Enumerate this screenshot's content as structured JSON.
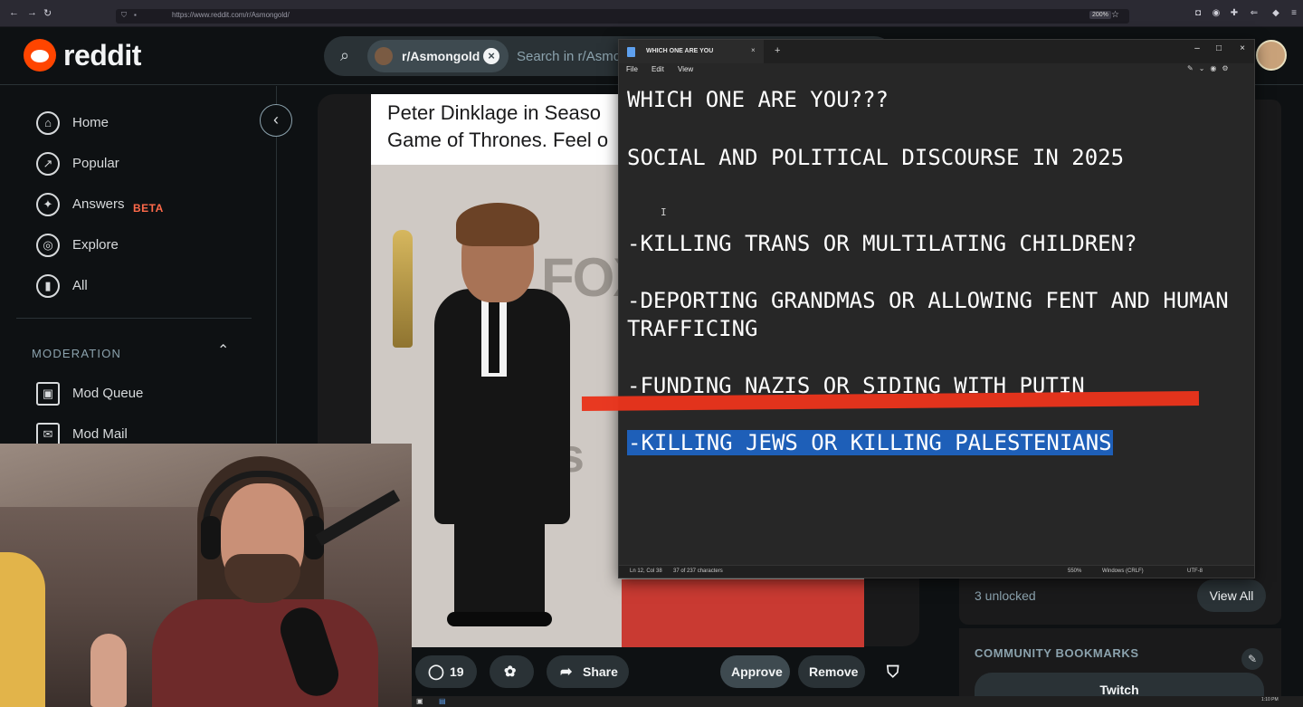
{
  "browser": {
    "url": "https://www.reddit.com/r/Asmongold/",
    "zoom": "200%",
    "nav_back": "←",
    "nav_forward": "→",
    "nav_reload": "↻"
  },
  "header": {
    "wordmark": "reddit",
    "subreddit_chip": "r/Asmongold",
    "chip_close": "×",
    "search_placeholder": "Search in r/Asmongold",
    "search_glyph": "⌕"
  },
  "sidebar": {
    "collapse_glyph": "‹",
    "items": [
      {
        "label": "Home",
        "icon": "home-icon",
        "glyph": "⌂"
      },
      {
        "label": "Popular",
        "icon": "popular-icon",
        "glyph": "↗"
      },
      {
        "label": "Answers",
        "icon": "answers-icon",
        "glyph": "✦"
      },
      {
        "label": "Explore",
        "icon": "explore-icon",
        "glyph": "◎"
      },
      {
        "label": "All",
        "icon": "all-icon",
        "glyph": "▮"
      }
    ],
    "answers_badge": "BETA",
    "moderation_heading": "MODERATION",
    "moderation_chevron": "⌃",
    "mod_items": [
      {
        "label": "Mod Queue",
        "icon": "mod-queue-icon",
        "glyph": "▣"
      },
      {
        "label": "Mod Mail",
        "icon": "mod-mail-icon",
        "glyph": "✉"
      }
    ]
  },
  "post": {
    "caption": "Peter Dinklage in Season Game of Thrones. Feel",
    "caption_line1": "Peter Dinklage in Seaso",
    "caption_line2": "Game of Thrones. Feel o",
    "backdrop_text_1": "FOX",
    "backdrop_text_2": "ys",
    "comment_count": "19",
    "share_label": "Share",
    "approve_label": "Approve",
    "remove_label": "Remove",
    "comment_glyph": "◯",
    "award_glyph": "✿",
    "share_glyph": "➦",
    "shield_glyph": "⛉"
  },
  "right_sidebar": {
    "unlocked_text": "3 unlocked",
    "view_all_label": "View All",
    "bookmarks_heading": "COMMUNITY BOOKMARKS",
    "bookmark_button": "Twitch",
    "edit_glyph": "✎"
  },
  "notepad": {
    "tab_title": "WHICH ONE ARE YOU",
    "menu": [
      "File",
      "Edit",
      "View"
    ],
    "lines": [
      "WHICH ONE ARE YOU???",
      "SOCIAL AND POLITICAL DISCOURSE IN 2025",
      "-KILLING TRANS OR MULTILATING CHILDREN?",
      "-DEPORTING GRANDMAS OR ALLOWING FENT AND HUMAN",
      "TRAFFICING",
      "-FUNDING NAZIS OR SIDING WITH PUTIN",
      "-KILLING JEWS OR KILLING PALESTENIANS"
    ],
    "status": {
      "position": "Ln 12, Col 38",
      "chars": "37 of 237 characters",
      "zoom": "550%",
      "line_ending": "Windows (CRLF)",
      "encoding": "UTF-8"
    },
    "window_controls": {
      "minimize": "–",
      "maximize": "□",
      "close": "×"
    },
    "new_tab": "+",
    "tab_close": "×"
  },
  "taskbar": {
    "clock": "1:10 PM"
  },
  "colors": {
    "reddit_orange": "#ff4500",
    "beta_red": "#ff6a4a",
    "selection_blue": "#1e5fb8",
    "strike_red": "#e8341c"
  }
}
